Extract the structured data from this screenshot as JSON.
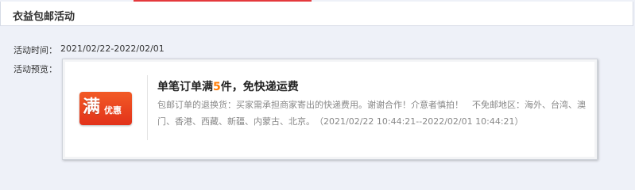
{
  "header": {
    "title": "衣益包邮活动"
  },
  "activity_time": {
    "label": "活动时间：",
    "value": "2021/02/22-2022/02/01"
  },
  "activity_preview": {
    "label": "活动预览："
  },
  "badge": {
    "main": "满",
    "sub": "优惠"
  },
  "promo": {
    "title_prefix": "单笔订单满",
    "title_number": "5",
    "title_suffix": "件，免快递运费",
    "description": "包邮订单的退换货：买家需承担商家寄出的快递费用。谢谢合作！介意者慎拍！　不免邮地区：海外、台湾、澳门、香港、西藏、新疆、内蒙古、北京。　（2021/02/22 10:44:21--2022/02/01 10:44:21）"
  },
  "colors": {
    "accent": "#e4393c",
    "highlight": "#ff7a00",
    "badge": "#e2321a"
  }
}
